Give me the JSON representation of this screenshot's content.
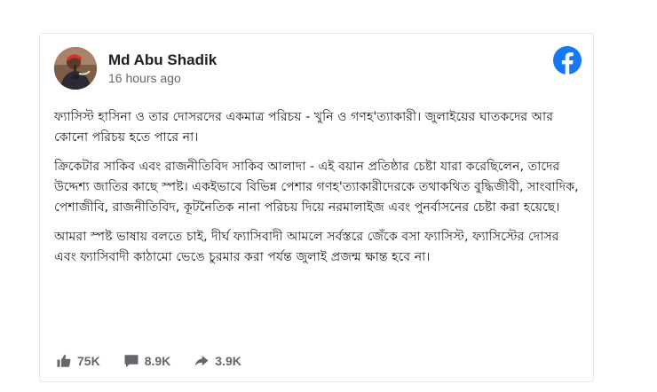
{
  "post": {
    "author": "Md Abu Shadik",
    "time": "16 hours ago",
    "paragraphs": [
      "ফ্যাসিস্ট হাসিনা ও তার দোসরদের একমাত্র পরিচয় - খুনি ও গণহ'ত্যাকারী। জুলাইয়ের ঘাতকদের আর কোনো পরিচয় হতে পারে না।",
      "ক্রিকেটার সাকিব এবং রাজনীতিবিদ সাকিব আলাদা - এই বয়ান প্রতিষ্ঠার চেষ্টা যারা করেছিলেন, তাদের উদ্দেশ্য জাতির কাছে স্পষ্ট। একইভাবে বিভিন্ন পেশার গণহ'ত্যাকারীদেরকে তথাকথিত বুদ্ধিজীবী, সাংবাদিক, পেশাজীবি, রাজনীতিবিদ, কূটনৈতিক নানা পরিচয় দিয়ে নরমালাইজ এবং পুনর্বাসনের চেষ্টা করা হয়েছে।",
      "আমরা স্পষ্ট ভাষায় বলতে চাই, দীর্ঘ ফ্যাসিবাদী আমলে সর্বস্তরে জেঁকে বসা ফ্যাসিস্ট, ফ্যাসিস্টের দোসর এবং ফ্যাসিবাদী কাঠামো ভেঙে চুরমার করা পর্যন্ত জুলাই প্রজন্ম ক্ষান্ত হবে না।"
    ]
  },
  "stats": {
    "likes": "75K",
    "comments": "8.9K",
    "shares": "3.9K"
  },
  "icons": {
    "brand": "facebook-logo-icon",
    "likes": "thumbs-up-icon",
    "comments": "comment-bubble-icon",
    "shares": "share-arrow-icon"
  },
  "colors": {
    "facebook_blue": "#1877f2",
    "text": "#1c1e21",
    "muted": "#65676b",
    "border": "#e4e6eb"
  }
}
